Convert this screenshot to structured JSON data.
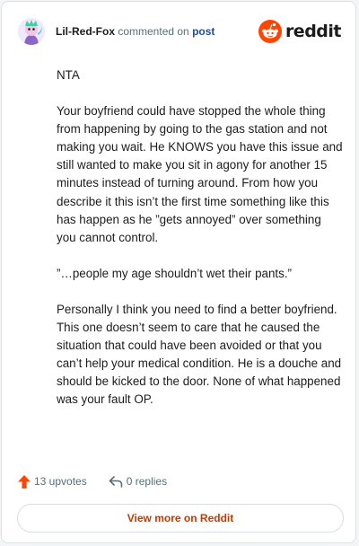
{
  "comment": {
    "author": "Lil-Red-Fox",
    "action_text": "commented on",
    "post_link": "post",
    "paragraphs": [
      "NTA",
      "Your boyfriend could have stopped the whole thing from happening by going to the gas station and not making you wait. He KNOWS you have this issue and still wanted to make you sit in agony for another 15 minutes instead of turning around. From how you describe it this isn’t the first time something like this has happen as he ”gets annoyed” over something you cannot control.",
      "”…people my age shouldn’t wet their pants.”",
      "Personally I think you need to find a better boyfriend. This one doesn’t seem to care that he caused the situation that could have been avoided or that you can’t help your medical condition. He is a douche and should be kicked to the door. None of what happened was your fault OP."
    ]
  },
  "brand": {
    "name": "reddit",
    "icon": "reddit-logo-icon",
    "color": "#ff4500"
  },
  "footer": {
    "upvotes": "13 upvotes",
    "upvote_icon": "upvote-arrow-icon",
    "upvote_color": "#ff4500",
    "replies": "0 replies",
    "reply_icon": "reply-arrow-icon"
  },
  "view_more": {
    "label": "View more on Reddit",
    "color": "#c63900"
  }
}
